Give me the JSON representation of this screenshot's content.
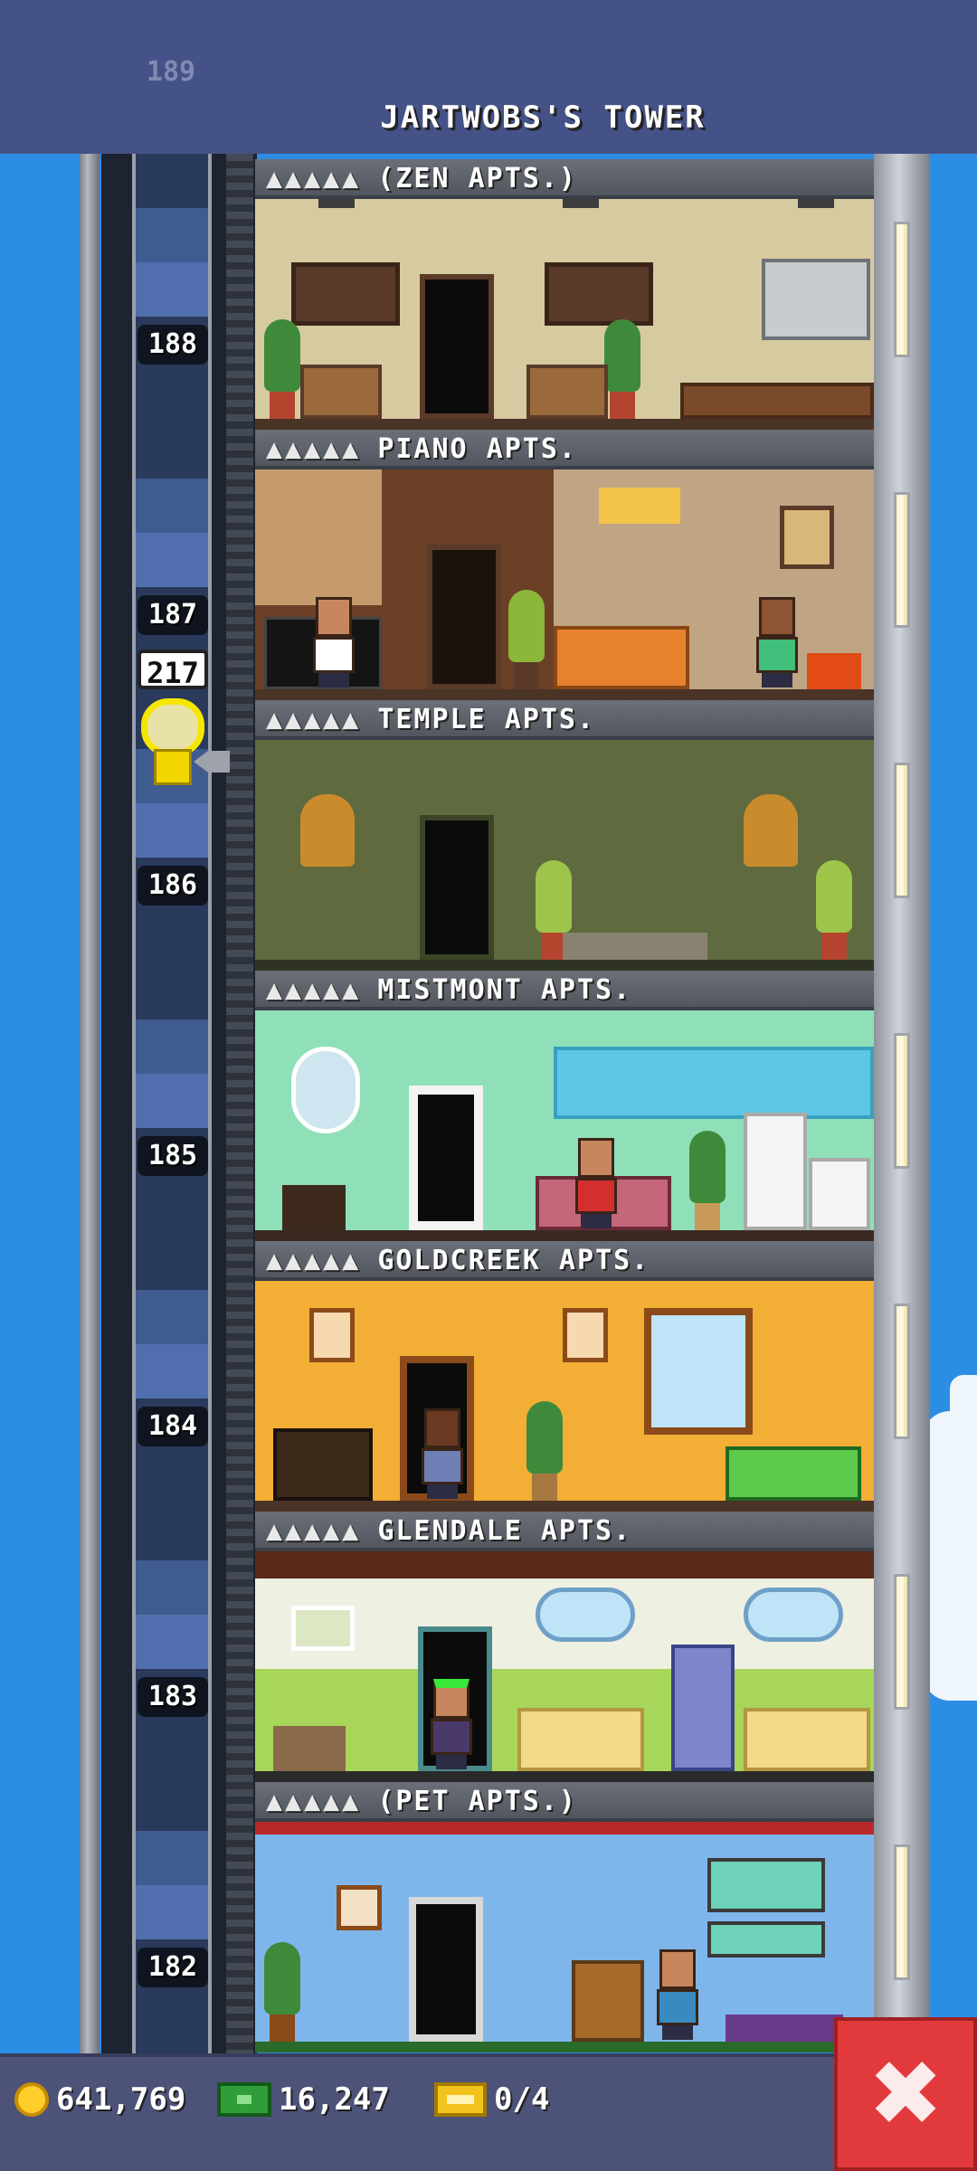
{
  "header": {
    "tower_name": "JARTWOBS'S TOWER",
    "top_floor_number": "189"
  },
  "floors": [
    {
      "number": "188",
      "stars": "▲▲▲▲▲",
      "name": "(ZEN APTS.)",
      "theme": "zen",
      "wall_color": "#d6caa0"
    },
    {
      "number": "187",
      "stars": "▲▲▲▲▲",
      "name": "PIANO APTS.",
      "theme": "piano",
      "wall_color": "#6b4027"
    },
    {
      "number": "186",
      "stars": "▲▲▲▲▲",
      "name": "TEMPLE APTS.",
      "theme": "temple",
      "wall_color": "#5f6a3f"
    },
    {
      "number": "185",
      "stars": "▲▲▲▲▲",
      "name": "MISTMONT APTS.",
      "theme": "mistmont",
      "wall_color": "#8fe0b8"
    },
    {
      "number": "184",
      "stars": "▲▲▲▲▲",
      "name": "GOLDCREEK APTS.",
      "theme": "goldcreek",
      "wall_color": "#f2ae35"
    },
    {
      "number": "183",
      "stars": "▲▲▲▲▲",
      "name": "GLENDALE APTS.",
      "theme": "glendale",
      "wall_color": "#eef0e2"
    },
    {
      "number": "182",
      "stars": "▲▲▲▲▲",
      "name": "(PET APTS.)",
      "theme": "pet",
      "wall_color": "#7eb6ec"
    }
  ],
  "elevator": {
    "passenger_count": "217"
  },
  "status_bar": {
    "coins": "641,769",
    "bux": "16,247",
    "tickets": "0/4"
  },
  "colors": {
    "sky": "#2c8de4",
    "status_bar": "#4d5279",
    "close_button": "#e23a3c",
    "elevator_highlight": "#f6e600"
  },
  "icons": {
    "coin": "coin-icon",
    "bux": "bux-icon",
    "ticket": "ticket-icon",
    "close": "close-icon"
  },
  "close_button": {
    "label": "✖"
  }
}
